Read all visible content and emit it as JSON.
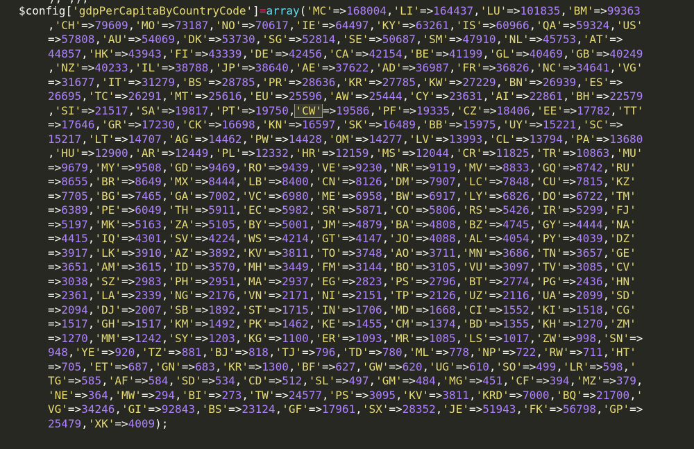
{
  "editor": {
    "theme_colors": {
      "background": "#272822",
      "variable": "#f8f8f2",
      "operator": "#f92672",
      "builtin": "#66d9ef",
      "string": "#e6db74",
      "number": "#ae81ff"
    },
    "prev_line_fragment": "),',),",
    "lines": [
      "$config['gdpPerCapitaByCountryCode']=array('MC'=>168004,'LI'=>164437,'LU'=>101835,'BM'=>99363",
      ",'CH'=>79609,'MO'=>73187,'NO'=>70617,'IE'=>64497,'KY'=>63261,'IS'=>60966,'QA'=>59324,'US'",
      "=>57808,'AU'=>54069,'DK'=>53730,'SG'=>52814,'SE'=>50687,'SM'=>47910,'NL'=>45753,'AT'=>",
      "44857,'HK'=>43943,'FI'=>43339,'DE'=>42456,'CA'=>42154,'BE'=>41199,'GL'=>40469,'GB'=>40249",
      ",'NZ'=>40233,'IL'=>38788,'JP'=>38640,'AE'=>37622,'AD'=>36987,'FR'=>36826,'NC'=>34641,'VG'",
      "=>31677,'IT'=>31279,'BS'=>28785,'PR'=>28636,'KR'=>27785,'KW'=>27229,'BN'=>26939,'ES'=>",
      "26695,'TC'=>26291,'MT'=>25616,'EU'=>25596,'AW'=>25444,'CY'=>23631,'AI'=>22861,'BH'=>22579",
      ",'SI'=>21517,'SA'=>19817,'PT'=>19750,'CW'=>19586,'PF'=>19335,'CZ'=>18406,'EE'=>17782,'TT'",
      "=>17646,'GR'=>17230,'CK'=>16698,'KN'=>16597,'SK'=>16489,'BB'=>15975,'UY'=>15221,'SC'=>",
      "15217,'LT'=>14707,'AG'=>14462,'PW'=>14428,'OM'=>14277,'LV'=>13993,'CL'=>13794,'PA'=>13680",
      ",'HU'=>12900,'AR'=>12449,'PL'=>12332,'HR'=>12159,'MS'=>12044,'CR'=>11825,'TR'=>10863,'MU'",
      "=>9679,'MY'=>9508,'GD'=>9469,'RO'=>9439,'VE'=>9230,'NR'=>9119,'MV'=>8833,'GQ'=>8742,'RU'",
      "=>8655,'BR'=>8649,'MX'=>8444,'LB'=>8400,'CN'=>8126,'DM'=>7907,'LC'=>7848,'CU'=>7815,'KZ'",
      "=>7705,'BG'=>7465,'GA'=>7002,'VC'=>6980,'ME'=>6958,'BW'=>6917,'LY'=>6826,'DO'=>6722,'TM'",
      "=>6389,'PE'=>6049,'TH'=>5911,'EC'=>5982,'SR'=>5871,'CO'=>5806,'RS'=>5426,'IR'=>5299,'FJ'",
      "=>5197,'MK'=>5163,'ZA'=>5105,'BY'=>5001,'JM'=>4879,'BA'=>4808,'BZ'=>4745,'GY'=>4444,'NA'",
      "=>4415,'IQ'=>4301,'SV'=>4224,'WS'=>4214,'GT'=>4147,'JO'=>4088,'AL'=>4054,'PY'=>4039,'DZ'",
      "=>3917,'LK'=>3910,'AZ'=>3892,'KV'=>3811,'TO'=>3748,'AO'=>3711,'MN'=>3686,'TN'=>3657,'GE'",
      "=>3651,'AM'=>3615,'ID'=>3570,'MH'=>3449,'FM'=>3144,'BO'=>3105,'VU'=>3097,'TV'=>3085,'CV'",
      "=>3038,'SZ'=>2983,'PH'=>2951,'MA'=>2937,'EG'=>2823,'PS'=>2796,'BT'=>2774,'PG'=>2436,'HN'",
      "=>2361,'LA'=>2339,'NG'=>2176,'VN'=>2171,'NI'=>2151,'TP'=>2126,'UZ'=>2116,'UA'=>2099,'SD'",
      "=>2094,'DJ'=>2007,'SB'=>1892,'ST'=>1715,'IN'=>1706,'MD'=>1668,'CI'=>1552,'KI'=>1518,'CG'",
      "=>1517,'GH'=>1517,'KM'=>1492,'PK'=>1462,'KE'=>1455,'CM'=>1374,'BD'=>1355,'KH'=>1270,'ZM'",
      "=>1270,'MM'=>1242,'SY'=>1203,'KG'=>1100,'ER'=>1093,'MR'=>1085,'LS'=>1017,'ZW'=>998,'SN'=>",
      "948,'YE'=>920,'TZ'=>881,'BJ'=>818,'TJ'=>796,'TD'=>780,'ML'=>778,'NP'=>722,'RW'=>711,'HT'",
      "=>705,'ET'=>687,'GN'=>683,'KR'=>1300,'BF'=>627,'GW'=>620,'UG'=>610,'SO'=>499,'LR'=>598,'",
      "TG'=>585,'AF'=>584,'SD'=>534,'CD'=>512,'SL'=>497,'GM'=>484,'MG'=>451,'CF'=>394,'MZ'=>379,",
      "'NE'=>364,'MW'=>294,'BI'=>273,'TW'=>24577,'PS'=>3095,'KV'=>3811,'KRD'=>7000,'BQ'=>21700,'",
      "VG'=>34246,'GI'=>92843,'BS'=>23124,'GF'=>17961,'SX'=>28352,'JE'=>51943,'FK'=>56798,'GP'=>",
      "25479,'XK'=>4009);"
    ],
    "selection": {
      "line": 7,
      "token": "'CW'"
    }
  }
}
